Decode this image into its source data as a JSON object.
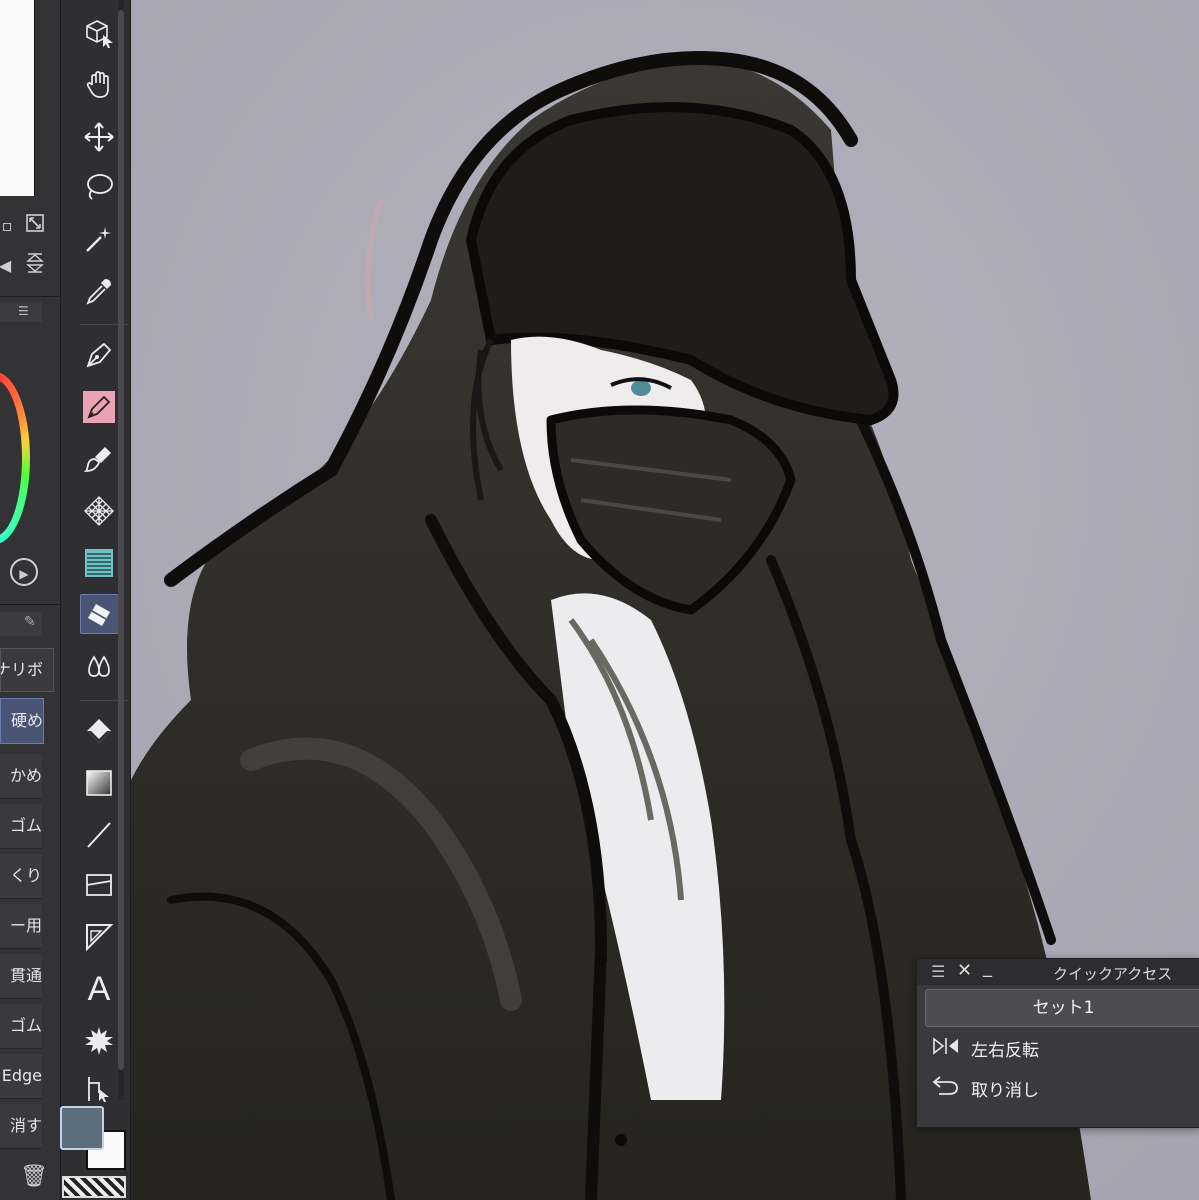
{
  "left_panel": {
    "sub_tool_tab": "ナリボ",
    "sub_tools": [
      "硬め",
      "かめ",
      "ゴム",
      "くり",
      "ー用",
      "貫通",
      "ゴム",
      "Edge",
      "消す"
    ],
    "active_sub_tool_index": 0
  },
  "toolbar": {
    "tools": [
      {
        "name": "operation-tool-icon"
      },
      {
        "name": "hand-tool-icon"
      },
      {
        "name": "move-layer-icon"
      },
      {
        "name": "lasso-selection-icon"
      },
      {
        "name": "auto-select-wand-icon"
      },
      {
        "name": "eyedropper-icon"
      },
      {
        "name": "pen-tool-icon"
      },
      {
        "name": "pencil-tool-icon"
      },
      {
        "name": "brush-tool-icon"
      },
      {
        "name": "airbrush-decoration-icon"
      },
      {
        "name": "decoration-tool-icon"
      },
      {
        "name": "eraser-tool-icon",
        "active": true
      },
      {
        "name": "blend-tool-icon"
      },
      {
        "name": "fill-tool-icon"
      },
      {
        "name": "gradient-tool-icon"
      },
      {
        "name": "figure-line-icon"
      },
      {
        "name": "frame-border-icon"
      },
      {
        "name": "ruler-tool-icon"
      },
      {
        "name": "text-tool-icon"
      },
      {
        "name": "balloon-tool-icon"
      },
      {
        "name": "correct-line-icon"
      }
    ],
    "text_tool_glyph": "A"
  },
  "colors": {
    "foreground": "#5c6e7c",
    "background": "#fafafa",
    "active_accent": "#4a5475"
  },
  "quick_access": {
    "title": "クイックアクセス",
    "set_label": "セット1",
    "items": [
      {
        "icon": "flip-horizontal-icon",
        "label": "左右反転"
      },
      {
        "icon": "undo-icon",
        "label": "取り消し"
      }
    ]
  }
}
